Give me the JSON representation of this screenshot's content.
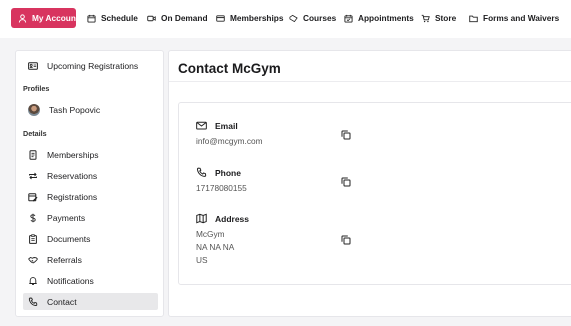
{
  "nav": {
    "items": [
      {
        "label": "My Account",
        "icon": "user-icon"
      },
      {
        "label": "Schedule",
        "icon": "calendar-icon"
      },
      {
        "label": "On Demand",
        "icon": "video-icon"
      },
      {
        "label": "Memberships",
        "icon": "card-icon"
      },
      {
        "label": "Courses",
        "icon": "tag-icon"
      },
      {
        "label": "Appointments",
        "icon": "calendar-check-icon"
      },
      {
        "label": "Store",
        "icon": "cart-icon"
      },
      {
        "label": "Forms and Waivers",
        "icon": "folder-icon"
      }
    ],
    "active_color": "#d8345f"
  },
  "sidebar": {
    "upcoming": "Upcoming Registrations",
    "profiles_heading": "Profiles",
    "profile_name": "Tash Popovic",
    "details_heading": "Details",
    "items": [
      {
        "label": "Memberships",
        "icon": "badge-icon"
      },
      {
        "label": "Reservations",
        "icon": "repeat-icon"
      },
      {
        "label": "Registrations",
        "icon": "calendar-edit-icon"
      },
      {
        "label": "Payments",
        "icon": "dollar-icon"
      },
      {
        "label": "Documents",
        "icon": "clipboard-icon"
      },
      {
        "label": "Referrals",
        "icon": "handshake-icon"
      },
      {
        "label": "Notifications",
        "icon": "bell-icon"
      },
      {
        "label": "Contact",
        "icon": "phone-icon"
      }
    ],
    "active_item": "Contact"
  },
  "main": {
    "title": "Contact McGym",
    "email": {
      "label": "Email",
      "value": "info@mcgym.com"
    },
    "phone": {
      "label": "Phone",
      "value": "17178080155"
    },
    "address": {
      "label": "Address",
      "lines": [
        "McGym",
        "NA NA NA",
        "US"
      ]
    }
  }
}
